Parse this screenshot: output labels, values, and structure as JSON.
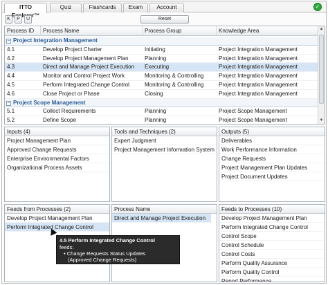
{
  "tabs": [
    {
      "label": "ITTO Explorer™",
      "active": true
    },
    {
      "label": "Quiz",
      "active": false
    },
    {
      "label": "Flashcards",
      "active": false
    },
    {
      "label": "Exam",
      "active": false
    },
    {
      "label": "Account",
      "active": false
    }
  ],
  "toolbar": {
    "btn_k": "K",
    "btn_p": "P",
    "btn_u": "U",
    "reset": "Reset"
  },
  "grid": {
    "columns": [
      "Process ID",
      "Process Name",
      "Process Group",
      "Knowledge Area"
    ],
    "groups": [
      {
        "title": "Project Integration Management",
        "toggle": "−",
        "rows": [
          {
            "id": "4.1",
            "name": "Develop Project Charter",
            "group": "Initiating",
            "area": "Project Integration Management"
          },
          {
            "id": "4.2",
            "name": "Develop Project Management Plan",
            "group": "Planning",
            "area": "Project Integration Management"
          },
          {
            "id": "4.3",
            "name": "Direct and Manage Project Execution",
            "group": "Executing",
            "area": "Project Integration Management",
            "selected": true
          },
          {
            "id": "4.4",
            "name": "Monitor and Control Project Work",
            "group": "Monitoring & Controlling",
            "area": "Project Integration Management"
          },
          {
            "id": "4.5",
            "name": "Perform Integrated Change Control",
            "group": "Monitoring & Controlling",
            "area": "Project Integration Management"
          },
          {
            "id": "4.6",
            "name": "Close Project or Phase",
            "group": "Closing",
            "area": "Project Integration Management"
          }
        ]
      },
      {
        "title": "Project Scope Management",
        "toggle": "−",
        "rows": [
          {
            "id": "5.1",
            "name": "Collect Requirements",
            "group": "Planning",
            "area": "Project Scope Management"
          },
          {
            "id": "5.2",
            "name": "Define Scope",
            "group": "Planning",
            "area": "Project Scope Management"
          }
        ]
      }
    ]
  },
  "inputs": {
    "title": "Inputs (4)",
    "items": [
      "Project Management Plan",
      "Approved Change Requests",
      "Enterprise Environmental Factors",
      "Organizational Process Assets"
    ]
  },
  "tools": {
    "title": "Tools and Techniques (2)",
    "items": [
      "Expert Judgment",
      "Project Management Information System"
    ]
  },
  "outputs": {
    "title": "Outputs (5)",
    "items": [
      "Deliverables",
      "Work Performance Information",
      "Change Requests",
      "Project Management Plan Updates",
      "Project Document Updates"
    ]
  },
  "feeds_from": {
    "title": "Feeds from Processes (2)",
    "items": [
      "Develop Project Management Plan",
      "Perform Integrated Change Control"
    ],
    "selected_index": 1
  },
  "process_name": {
    "title": "Process Name",
    "items": [
      "Direct and Manage Project Execution"
    ]
  },
  "feeds_to": {
    "title": "Feeds to Processes (10)",
    "items": [
      "Develop Project Management Plan",
      "Perform Integrated Change Control",
      "Control Scope",
      "Control Schedule",
      "Control Costs",
      "Perform Quality Assurance",
      "Perform Quality Control",
      "Report Performance"
    ]
  },
  "tooltip": {
    "title": "4.5 Perform Integrated Change Control",
    "sub": "feeds:",
    "bullet": "•",
    "line1": "Change Requests Status Updates",
    "line2": "(Approved Change Requests)"
  },
  "colors": {
    "selection": "#d5e5f5",
    "group_header": "#2a5a96",
    "logo": "#2fa83a"
  }
}
